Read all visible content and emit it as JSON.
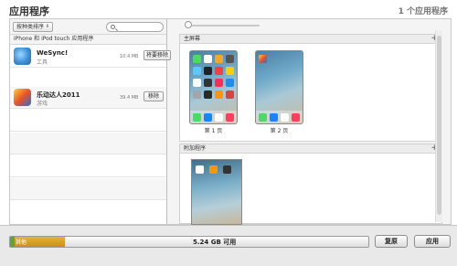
{
  "header": {
    "title": "应用程序",
    "count": "1 个应用程序"
  },
  "left": {
    "sort_label": "按种类排序",
    "section_title": "iPhone 和 iPod touch 应用程序",
    "apps": [
      {
        "name": "WeSync!",
        "category": "工具",
        "size": "10.4 MB",
        "action": "将要移除",
        "icon": "wesync-icon",
        "icon_color": "#3a8fd9"
      },
      {
        "name": "乐动达人2011",
        "category": "游戏",
        "size": "39.4 MB",
        "action": "移除",
        "icon": "game-icon",
        "icon_color": "#d9443a"
      }
    ]
  },
  "right": {
    "home_title": "主屏幕",
    "pages": [
      {
        "label": "第 1 页"
      },
      {
        "label": "第 2 页"
      }
    ],
    "extra_title": "附加程序"
  },
  "status": {
    "segment_label": "其他",
    "free": "5.24 GB 可用",
    "segment_fraction": 0.14,
    "revert_label": "复原",
    "apply_label": "应用"
  },
  "colors": {
    "capacity_audio": "#5aa63a",
    "capacity_other": "#e8b23a"
  }
}
